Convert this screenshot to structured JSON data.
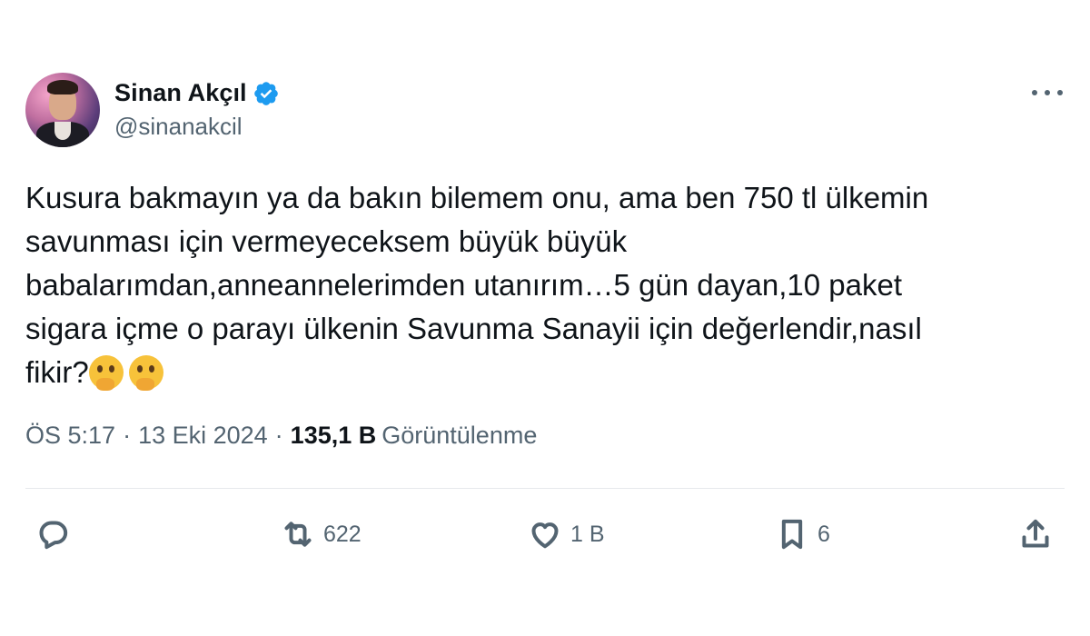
{
  "author": {
    "display_name": "Sinan Akçıl",
    "handle": "@sinanakcil",
    "verified": true,
    "avatar_icon": "avatar-photo"
  },
  "tweet": {
    "lines": [
      "Kusura bakmayın ya da bakın bilemem onu, ama ben 750 tl ülkemin",
      "savunması için vermeyeceksem büyük büyük",
      "babalarımdan,anneannelerimden utanırım…5 gün dayan,10 paket",
      "sigara içme o parayı ülkenin Savunma Sanayii için değerlendir,nasıl",
      "fikir?"
    ],
    "emojis": [
      "thinking-face",
      "thinking-face"
    ]
  },
  "meta": {
    "time": "ÖS 5:17",
    "separator": "·",
    "date": "13 Eki 2024",
    "views_count": "135,1 B",
    "views_label": "Görüntülenme"
  },
  "actions": {
    "reply": {
      "icon": "reply-icon",
      "count": ""
    },
    "retweet": {
      "icon": "retweet-icon",
      "count": "622"
    },
    "like": {
      "icon": "heart-icon",
      "count": "1 B"
    },
    "bookmark": {
      "icon": "bookmark-icon",
      "count": "6"
    },
    "share": {
      "icon": "share-icon",
      "count": ""
    }
  },
  "colors": {
    "text_primary": "#0f1419",
    "text_secondary": "#536471",
    "verified_blue": "#1d9bf0",
    "divider": "#e6e9ec"
  }
}
